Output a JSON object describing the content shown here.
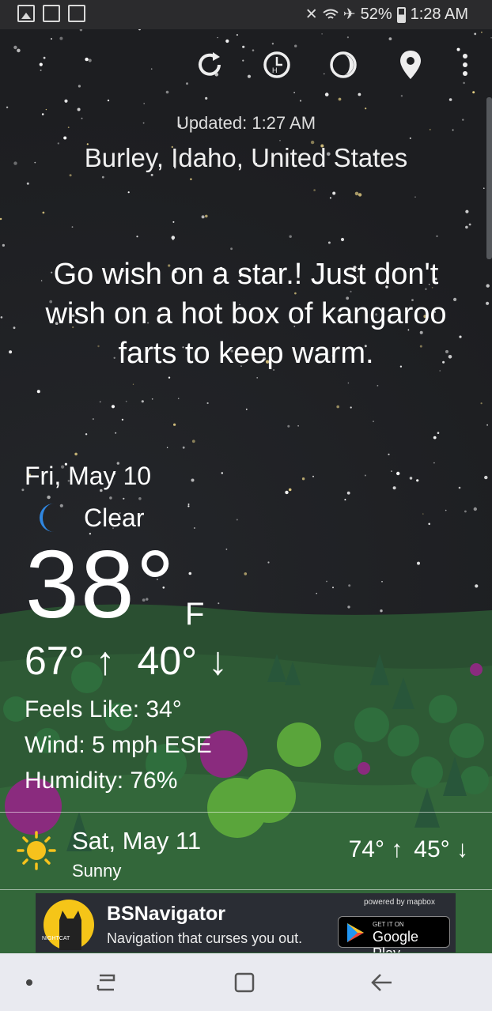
{
  "status_bar": {
    "battery": "52%",
    "time": "1:28 AM",
    "icons": [
      "image-icon",
      "screen-record-icon",
      "sim-icon",
      "mute-icon",
      "wifi-icon",
      "airplane-icon",
      "battery-icon"
    ]
  },
  "toolbar": {
    "icons": [
      "refresh-icon",
      "hourly-icon",
      "moon-phase-icon",
      "location-pin-icon",
      "more-vert-icon"
    ]
  },
  "header": {
    "updated": "Updated: 1:27 AM",
    "location": "Burley, Idaho, United States"
  },
  "quote": "Go wish on a star.! Just don't wish on a hot box of kangaroo farts to keep warm.",
  "current": {
    "date": "Fri, May 10",
    "condition": "Clear",
    "condition_icon": "crescent-moon-icon",
    "temperature": "38°",
    "unit": "F",
    "high": "67° ↑",
    "low": "40° ↓",
    "feels_like": "Feels Like: 34°",
    "wind": "Wind: 5 mph ESE",
    "humidity": "Humidity: 76%"
  },
  "forecast": [
    {
      "date": "Sat, May 11",
      "condition": "Sunny",
      "icon": "sun-icon",
      "high": "74° ↑",
      "low": "45° ↓"
    }
  ],
  "ad": {
    "title": "BSNavigator",
    "subtitle": "Navigation that curses you out.",
    "powered_by": "powered by mapbox",
    "store_get": "GET IT ON",
    "store_name": "Google Play"
  },
  "colors": {
    "sky": "#1e1f21",
    "hills": "#2c5a35",
    "moon": "#2f86e0",
    "sun": "#f6c21c",
    "navbar": "#e9eaf0"
  }
}
